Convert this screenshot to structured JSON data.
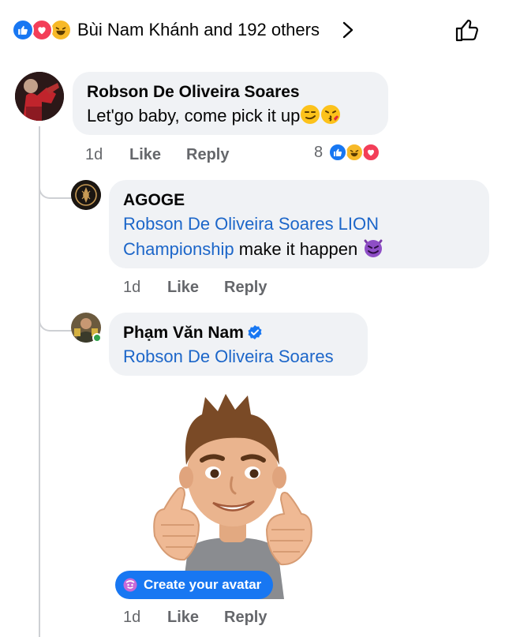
{
  "reactions": {
    "types": [
      "like",
      "love",
      "haha"
    ],
    "summary": "Bùi Nam Khánh and 192 others"
  },
  "comments": [
    {
      "author": "Robson De Oliveira Soares",
      "text": "Let'go baby, come pick it up",
      "time": "1d",
      "like": "Like",
      "reply": "Reply",
      "reaction_count": "8"
    }
  ],
  "replies": [
    {
      "author": "AGOGE",
      "mention": "Robson De Oliveira Soares LION Championship",
      "text": "make it happen",
      "time": "1d",
      "like": "Like",
      "reply": "Reply"
    },
    {
      "author": "Phạm Văn Nam",
      "verified": true,
      "mention": "Robson De Oliveira Soares",
      "sticker_cta": "Create your avatar",
      "time": "1d",
      "like": "Like",
      "reply": "Reply"
    }
  ],
  "colors": {
    "link": "#1c66c9",
    "accent": "#1877f2",
    "bubble": "#f0f2f5",
    "meta": "#65676b"
  }
}
